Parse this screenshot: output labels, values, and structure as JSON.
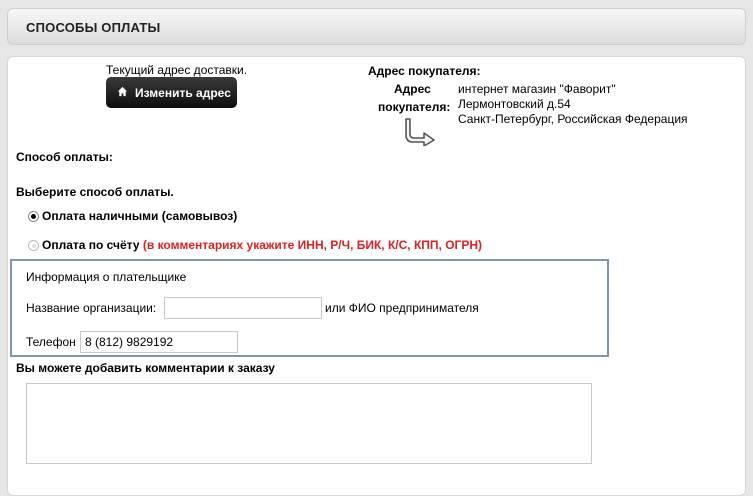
{
  "header": {
    "title": "СПОСОБЫ ОПЛАТЫ"
  },
  "shipping": {
    "current_label": "Текущий адрес доставки.",
    "change_button": "Изменить адрес",
    "button_icon": "home-icon"
  },
  "buyer_address": {
    "heading": "Адрес покупателя:",
    "side_label_line1": "Адрес",
    "side_label_line2": "покупателя:",
    "lines": [
      "интернет магазин \"Фаворит\"",
      "Лермонтовский д.54",
      "Санкт-Петербург, Российская Федерация"
    ]
  },
  "payment": {
    "method_label": "Способ оплаты:",
    "choose_label": "Выберите способ оплаты.",
    "options": [
      {
        "label": "Оплата наличными (самовывоз)",
        "selected": true,
        "note": ""
      },
      {
        "label": "Оплата по счёту",
        "selected": false,
        "note": "(в комментариях укажите ИНН, Р/Ч, БИК, К/С, КПП, ОГРН)"
      }
    ],
    "note_color": "#e02020"
  },
  "payer_info": {
    "title": "Информация о плательщике",
    "org_label": "Название организации:",
    "org_value": "",
    "or_label": "или ФИО предпринимателя",
    "phone_label": "Телефон",
    "phone_value": "8 (812) 9829192",
    "border_color": "#7e95ad"
  },
  "comments": {
    "label": "Вы можете добавить комментарии к заказу",
    "value": ""
  }
}
